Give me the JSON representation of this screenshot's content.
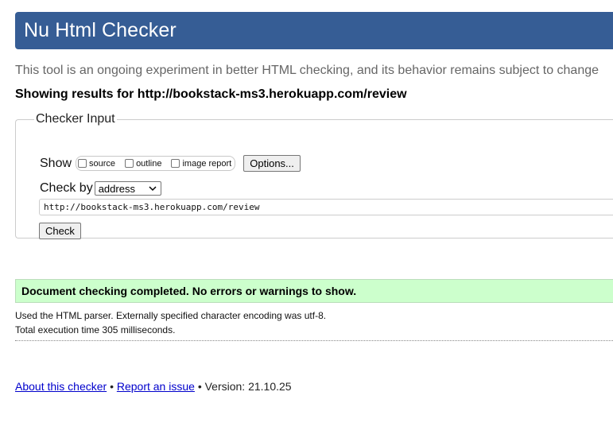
{
  "header": {
    "title": "Nu Html Checker"
  },
  "intro": "This tool is an ongoing experiment in better HTML checking, and its behavior remains subject to change",
  "showing": "Showing results for http://bookstack-ms3.herokuapp.com/review",
  "checker_input": {
    "legend": "Checker Input",
    "show_label": "Show",
    "checkboxes": [
      {
        "label": "source",
        "checked": false
      },
      {
        "label": "outline",
        "checked": false
      },
      {
        "label": "image report",
        "checked": false
      }
    ],
    "options_button": "Options...",
    "check_by_label": "Check by",
    "check_by_value": "address",
    "url_value": "http://bookstack-ms3.herokuapp.com/review",
    "check_button": "Check"
  },
  "result": {
    "message": "Document checking completed. No errors or warnings to show.",
    "parser_note": "Used the HTML parser. Externally specified character encoding was utf-8.",
    "execution_time": "Total execution time 305 milliseconds."
  },
  "footer": {
    "about_link": "About this checker",
    "separator": "•",
    "report_link": "Report an issue",
    "version": "Version: 21.10.25"
  },
  "colors": {
    "header_bg": "#365d95",
    "success_bg": "#ccffcc",
    "link": "#0000cc"
  }
}
